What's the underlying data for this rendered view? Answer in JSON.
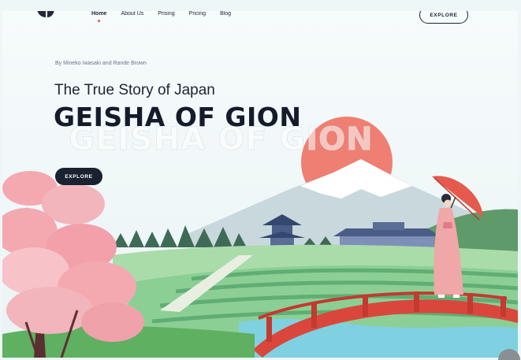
{
  "nav": {
    "items": [
      {
        "label": "Home",
        "active": true
      },
      {
        "label": "About Us",
        "active": false
      },
      {
        "label": "Prising",
        "active": false
      },
      {
        "label": "Pricing",
        "active": false
      },
      {
        "label": "Blog",
        "active": false
      }
    ],
    "explore_label": "EXPLORE"
  },
  "hero": {
    "byline": "By Mineko Iwasaki and Rande Brown",
    "subtitle": "The True Story of Japan",
    "title": "GEISHA OF GION",
    "ghost_title": "GEISHA OF GION",
    "explore_label": "EXPLORE"
  },
  "colors": {
    "sun": "#ef7f72",
    "dark": "#1a2130",
    "accent_dot": "#e4574a",
    "blossom": "#f4a9b1",
    "bridge": "#d9473c",
    "field": "#8ccf95"
  }
}
